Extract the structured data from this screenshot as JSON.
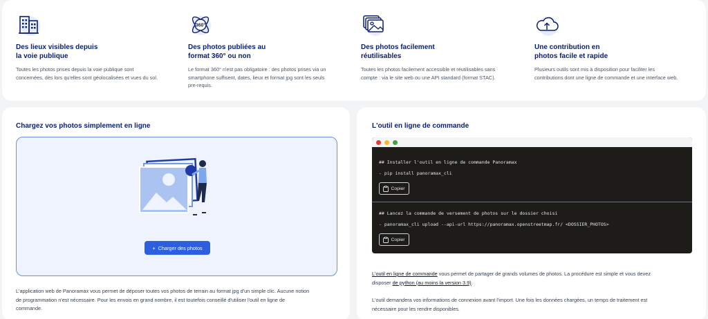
{
  "features": [
    {
      "icon": "buildings-icon",
      "title_line1": "Des lieux visibles depuis",
      "title_line2": "la voie publique",
      "desc_lines": [
        "Toutes les photos prises depuis la voie publique sont",
        "concernées, dès lors qu'elles sont géolocalisées et vues du sol."
      ]
    },
    {
      "icon": "photo-360-icon",
      "icon_text": "360°",
      "title_line1": "Des photos publiées au",
      "title_line2": "format 360° ou non",
      "desc_lines": [
        "Le format 360° n'est pas obligatoire : des photos prises via un",
        "smartphone suffisent, dates, lieux et format jpg sont les seuls",
        "pre-requis."
      ]
    },
    {
      "icon": "images-stack-icon",
      "title_line1": "Des photos facilement",
      "title_line2": "réutilisables",
      "desc_lines": [
        "Toutes les photos facilement accessible et réutilisables sans",
        "compte : via le site web ou une API standard (format STAC)."
      ]
    },
    {
      "icon": "cloud-upload-icon",
      "title_line1": "Une contribution en",
      "title_line2": "photos facile et rapide",
      "desc_lines": [
        "Plusieurs outils sont mis à disposition pour faciliter les",
        "contributions dont une ligne de commande et une interface web."
      ]
    }
  ],
  "upload": {
    "title": "Chargez vos photos simplement en ligne",
    "button_icon": "+",
    "button_label": "Charger des photos",
    "desc_lines": [
      "L'application web de Panoramax vous permet de déposer toutes vos photos de terrain au format jpg d'un simple clic. Aucune notion",
      "de programmation n'est nécessaire. Pour les envois en grand nombre, il est toutefois conseillé d'utiliser l'outil en ligne de",
      "commande."
    ]
  },
  "cli": {
    "title": "L'outil en ligne de commande",
    "blocks": [
      {
        "comment": "## Installer l'outil en ligne de commande Panoramax",
        "command": "- pip install panoramax_cli",
        "copy_label": "Copier"
      },
      {
        "comment": "## Lancez la commande de versement de photos sur le dossier choisi",
        "command": "- panoramax_cli upload --api-url https://panoramax.openstreetmap.fr/ <DOSSIER_PHOTOS>",
        "copy_label": "Copier"
      }
    ],
    "p1_link": "L'outil en ligne de commande",
    "p1_text": " vous permet de partager de grands volumes de photos. La procédure est simple et vous devez",
    "p1_line2_pre": "disposer ",
    "p1_link2": "de python (au moins la version 3.9)",
    "p1_line2_post": ".",
    "p2_lines": [
      "L'outil demandera vos informations de connexion avant l'import. Une fois les données chargées, un temps de traitement est",
      "nécessaire pour les rendre disponibles."
    ]
  },
  "colors": {
    "accent": "#2b5fe0",
    "title": "#0a1e6e",
    "terminal": "#1e1c18",
    "dot_red": "#e53935",
    "dot_yellow": "#f5b82e",
    "dot_green": "#43a047"
  }
}
